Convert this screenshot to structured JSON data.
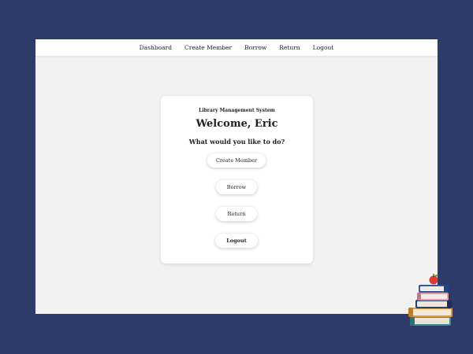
{
  "nav": {
    "items": [
      {
        "label": "Dashboard"
      },
      {
        "label": "Create Member"
      },
      {
        "label": "Borrow"
      },
      {
        "label": "Return"
      },
      {
        "label": "Logout"
      }
    ]
  },
  "card": {
    "subtitle": "Library Management System",
    "title": "Welcome, Eric",
    "question": "What would you like to do?",
    "buttons": {
      "create_member": "Create Member",
      "borrow": "Borrow",
      "return": "Return",
      "logout": "Logout"
    }
  },
  "colors": {
    "background": "#2e3a68",
    "content_bg": "#f2f2f2",
    "card_bg": "#ffffff"
  },
  "icons": {
    "illustration": "books-stack-apple-illustration"
  }
}
